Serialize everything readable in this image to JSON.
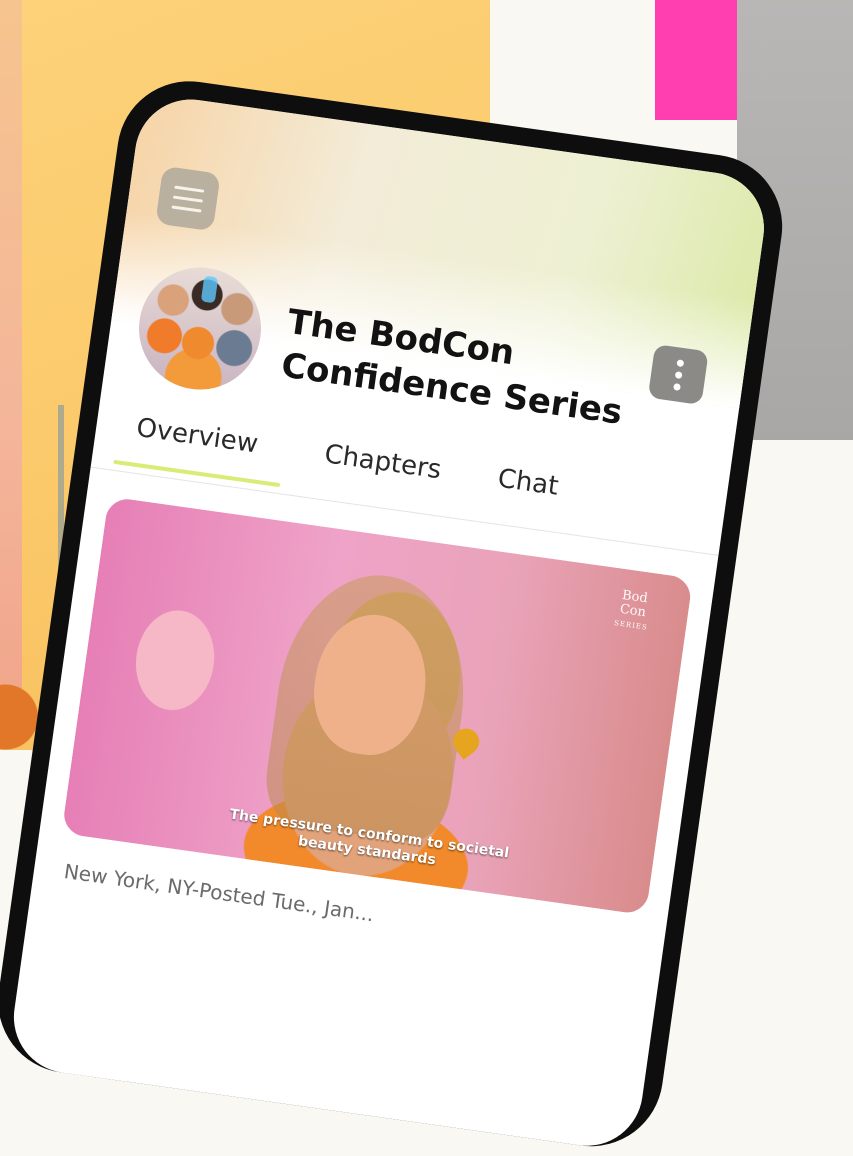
{
  "app": {
    "title_line1": "The BodCon",
    "title_line2": "Confidence Series"
  },
  "tabs": [
    {
      "label": "Overview",
      "active": true
    },
    {
      "label": "Chapters",
      "active": false
    },
    {
      "label": "Chat",
      "active": false
    }
  ],
  "video": {
    "watermark_line1": "Bod",
    "watermark_line2": "Con",
    "watermark_line3": "SERIES",
    "subtitle": "The pressure to conform to societal beauty standards"
  },
  "meta": {
    "location_posted": "New York, NY-Posted Tue., Jan..."
  },
  "colors": {
    "tab_underline": "#d8ec77",
    "accent_pink": "#ff3fb0",
    "background_orange": "#fdd27a"
  },
  "icons": {
    "menu": "hamburger-menu-icon",
    "more": "vertical-dots-icon"
  }
}
